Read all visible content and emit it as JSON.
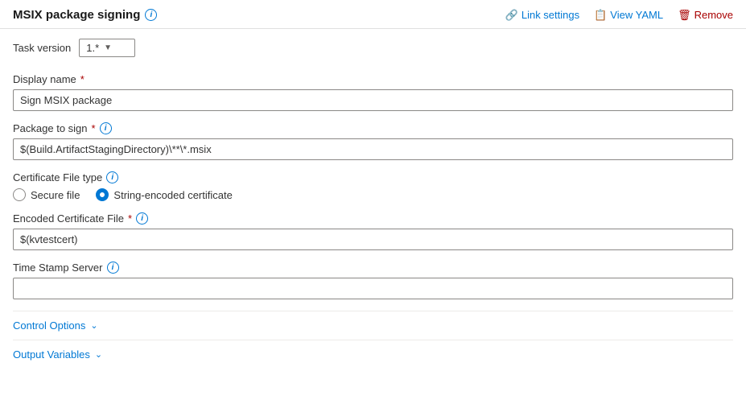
{
  "header": {
    "title": "MSIX package signing",
    "link_settings_label": "Link settings",
    "view_yaml_label": "View YAML",
    "remove_label": "Remove"
  },
  "task_version": {
    "label": "Task version",
    "value": "1.*"
  },
  "display_name": {
    "label": "Display name",
    "required": true,
    "value": "Sign MSIX package"
  },
  "package_to_sign": {
    "label": "Package to sign",
    "required": true,
    "value": "$(Build.ArtifactStagingDirectory)\\**\\*.msix"
  },
  "certificate_file_type": {
    "label": "Certificate File type",
    "options": [
      {
        "id": "secure_file",
        "label": "Secure file",
        "selected": false
      },
      {
        "id": "string_encoded",
        "label": "String-encoded certificate",
        "selected": true
      }
    ]
  },
  "encoded_certificate_file": {
    "label": "Encoded Certificate File",
    "required": true,
    "value": "$(kvtestcert)"
  },
  "time_stamp_server": {
    "label": "Time Stamp Server",
    "value": ""
  },
  "control_options": {
    "label": "Control Options"
  },
  "output_variables": {
    "label": "Output Variables"
  }
}
